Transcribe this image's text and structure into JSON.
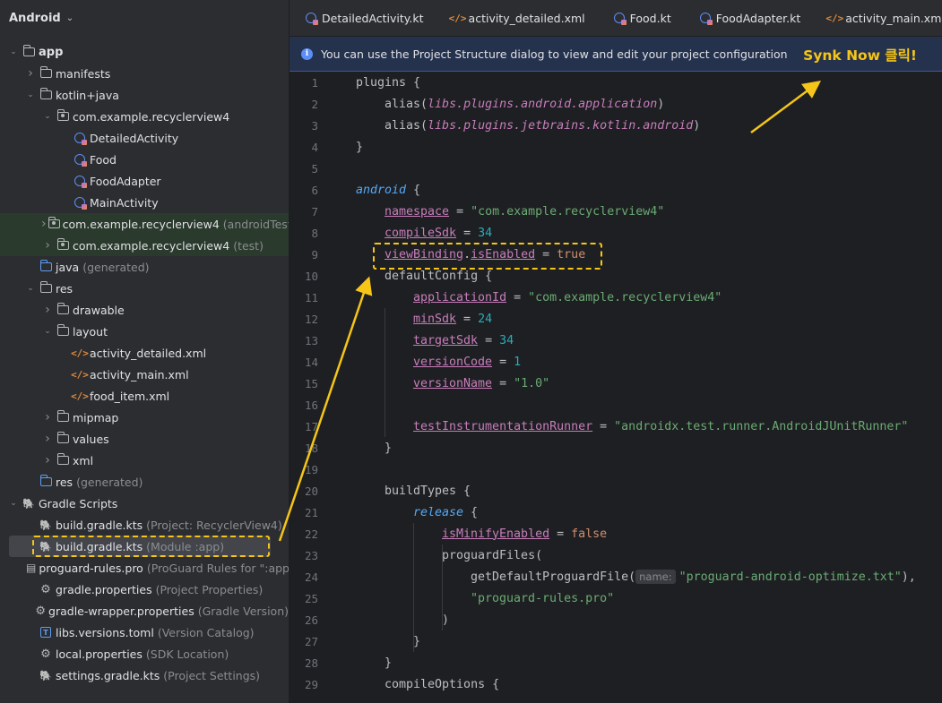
{
  "sidebar": {
    "title": "Android",
    "tree": [
      {
        "label": "app",
        "icon": "module-folder-icon",
        "arrow": "▾",
        "depth": 0,
        "bold": true
      },
      {
        "label": "manifests",
        "icon": "folder-icon",
        "arrow": "›",
        "depth": 1
      },
      {
        "label": "kotlin+java",
        "icon": "folder-icon",
        "arrow": "▾",
        "depth": 1
      },
      {
        "label": "com.example.recyclerview4",
        "icon": "package-icon",
        "arrow": "▾",
        "depth": 2
      },
      {
        "label": "DetailedActivity",
        "icon": "kotlin-class-icon",
        "depth": 3
      },
      {
        "label": "Food",
        "icon": "kotlin-class-icon",
        "depth": 3
      },
      {
        "label": "FoodAdapter",
        "icon": "kotlin-class-icon",
        "depth": 3
      },
      {
        "label": "MainActivity",
        "icon": "kotlin-class-icon",
        "depth": 3
      },
      {
        "label": "com.example.recyclerview4",
        "sub": "(androidTest)",
        "icon": "package-icon",
        "arrow": "›",
        "depth": 2,
        "green": true
      },
      {
        "label": "com.example.recyclerview4",
        "sub": "(test)",
        "icon": "package-icon",
        "arrow": "›",
        "depth": 2,
        "green": true
      },
      {
        "label": "java",
        "sub": "(generated)",
        "icon": "generated-folder-icon",
        "depth": 1
      },
      {
        "label": "res",
        "icon": "folder-icon",
        "arrow": "▾",
        "depth": 1
      },
      {
        "label": "drawable",
        "icon": "folder-icon",
        "arrow": "›",
        "depth": 2
      },
      {
        "label": "layout",
        "icon": "folder-icon",
        "arrow": "▾",
        "depth": 2
      },
      {
        "label": "activity_detailed.xml",
        "icon": "xml-icon",
        "depth": 3
      },
      {
        "label": "activity_main.xml",
        "icon": "xml-icon",
        "depth": 3
      },
      {
        "label": "food_item.xml",
        "icon": "xml-icon",
        "depth": 3
      },
      {
        "label": "mipmap",
        "icon": "folder-icon",
        "arrow": "›",
        "depth": 2
      },
      {
        "label": "values",
        "icon": "folder-icon",
        "arrow": "›",
        "depth": 2
      },
      {
        "label": "xml",
        "icon": "folder-icon",
        "arrow": "›",
        "depth": 2
      },
      {
        "label": "res",
        "sub": "(generated)",
        "icon": "generated-folder-icon",
        "depth": 1
      },
      {
        "label": "Gradle Scripts",
        "icon": "gradle-icon",
        "arrow": "▾",
        "depth": 0
      },
      {
        "label": "build.gradle.kts",
        "sub": "(Project: RecyclerView4)",
        "icon": "gradle-icon",
        "depth": 1
      },
      {
        "label": "build.gradle.kts",
        "sub": "(Module :app)",
        "icon": "gradle-icon",
        "depth": 1,
        "selected": true
      },
      {
        "label": "proguard-rules.pro",
        "sub": "(ProGuard Rules for \":app\")",
        "icon": "file-icon",
        "depth": 1
      },
      {
        "label": "gradle.properties",
        "sub": "(Project Properties)",
        "icon": "gear-icon",
        "depth": 1
      },
      {
        "label": "gradle-wrapper.properties",
        "sub": "(Gradle Version)",
        "icon": "gear-icon",
        "depth": 1
      },
      {
        "label": "libs.versions.toml",
        "sub": "(Version Catalog)",
        "icon": "toml-icon",
        "depth": 1
      },
      {
        "label": "local.properties",
        "sub": "(SDK Location)",
        "icon": "gear-icon",
        "depth": 1
      },
      {
        "label": "settings.gradle.kts",
        "sub": "(Project Settings)",
        "icon": "gradle-icon",
        "depth": 1
      }
    ]
  },
  "tabs": [
    {
      "label": "DetailedActivity.kt",
      "icon": "kotlin-class-icon"
    },
    {
      "label": "activity_detailed.xml",
      "icon": "xml-icon"
    },
    {
      "label": "Food.kt",
      "icon": "kotlin-class-icon"
    },
    {
      "label": "FoodAdapter.kt",
      "icon": "kotlin-class-icon"
    },
    {
      "label": "activity_main.xml",
      "icon": "xml-icon"
    }
  ],
  "banner": {
    "text": "You can use the Project Structure dialog to view and edit your project configuration",
    "annotation": "Synk Now 클릭!"
  },
  "editor": {
    "lines": [
      {
        "n": "1",
        "indent": 0,
        "tokens": [
          {
            "t": "plugins {",
            "c": ""
          }
        ]
      },
      {
        "n": "2",
        "indent": 1,
        "tokens": [
          {
            "t": "alias(",
            "c": ""
          },
          {
            "t": "libs.plugins.android.application",
            "c": "ital"
          },
          {
            "t": ")",
            "c": ""
          }
        ]
      },
      {
        "n": "3",
        "indent": 1,
        "tokens": [
          {
            "t": "alias(",
            "c": ""
          },
          {
            "t": "libs.plugins.jetbrains.kotlin.android",
            "c": "ital"
          },
          {
            "t": ")",
            "c": ""
          }
        ]
      },
      {
        "n": "4",
        "indent": 0,
        "tokens": [
          {
            "t": "}",
            "c": ""
          }
        ]
      },
      {
        "n": "5",
        "indent": 0,
        "tokens": []
      },
      {
        "n": "6",
        "indent": 0,
        "tokens": [
          {
            "t": "android",
            "c": "blue"
          },
          {
            "t": " {",
            "c": ""
          }
        ]
      },
      {
        "n": "7",
        "indent": 1,
        "tokens": [
          {
            "t": "namespace",
            "c": "prop"
          },
          {
            "t": " = ",
            "c": ""
          },
          {
            "t": "\"com.example.recyclerview4\"",
            "c": "str"
          }
        ]
      },
      {
        "n": "8",
        "indent": 1,
        "tokens": [
          {
            "t": "compileSdk",
            "c": "prop"
          },
          {
            "t": " = ",
            "c": ""
          },
          {
            "t": "34",
            "c": "num"
          }
        ]
      },
      {
        "n": "9",
        "indent": 1,
        "tokens": [
          {
            "t": "viewBinding",
            "c": "prop"
          },
          {
            "t": ".",
            "c": ""
          },
          {
            "t": "isEnabled",
            "c": "prop"
          },
          {
            "t": " = ",
            "c": ""
          },
          {
            "t": "true",
            "c": "kw"
          }
        ]
      },
      {
        "n": "10",
        "indent": 1,
        "tokens": [
          {
            "t": "defaultConfig {",
            "c": ""
          }
        ]
      },
      {
        "n": "11",
        "indent": 2,
        "tokens": [
          {
            "t": "applicationId",
            "c": "prop"
          },
          {
            "t": " = ",
            "c": ""
          },
          {
            "t": "\"com.example.recyclerview4\"",
            "c": "str"
          }
        ]
      },
      {
        "n": "12",
        "indent": 2,
        "tokens": [
          {
            "t": "minSdk",
            "c": "prop"
          },
          {
            "t": " = ",
            "c": ""
          },
          {
            "t": "24",
            "c": "num"
          }
        ]
      },
      {
        "n": "13",
        "indent": 2,
        "tokens": [
          {
            "t": "targetSdk",
            "c": "prop"
          },
          {
            "t": " = ",
            "c": ""
          },
          {
            "t": "34",
            "c": "num"
          }
        ]
      },
      {
        "n": "14",
        "indent": 2,
        "tokens": [
          {
            "t": "versionCode",
            "c": "prop"
          },
          {
            "t": " = ",
            "c": ""
          },
          {
            "t": "1",
            "c": "num"
          }
        ]
      },
      {
        "n": "15",
        "indent": 2,
        "tokens": [
          {
            "t": "versionName",
            "c": "prop"
          },
          {
            "t": " = ",
            "c": ""
          },
          {
            "t": "\"1.0\"",
            "c": "str"
          }
        ]
      },
      {
        "n": "16",
        "indent": 0,
        "tokens": []
      },
      {
        "n": "17",
        "indent": 2,
        "tokens": [
          {
            "t": "testInstrumentationRunner",
            "c": "prop"
          },
          {
            "t": " = ",
            "c": ""
          },
          {
            "t": "\"androidx.test.runner.AndroidJUnitRunner\"",
            "c": "str"
          }
        ]
      },
      {
        "n": "18",
        "indent": 1,
        "tokens": [
          {
            "t": "}",
            "c": ""
          }
        ]
      },
      {
        "n": "19",
        "indent": 0,
        "tokens": []
      },
      {
        "n": "20",
        "indent": 1,
        "tokens": [
          {
            "t": "buildTypes {",
            "c": ""
          }
        ]
      },
      {
        "n": "21",
        "indent": 2,
        "tokens": [
          {
            "t": "release",
            "c": "blue"
          },
          {
            "t": " {",
            "c": ""
          }
        ]
      },
      {
        "n": "22",
        "indent": 3,
        "tokens": [
          {
            "t": "isMinifyEnabled",
            "c": "prop"
          },
          {
            "t": " = ",
            "c": ""
          },
          {
            "t": "false",
            "c": "kw"
          }
        ]
      },
      {
        "n": "23",
        "indent": 3,
        "tokens": [
          {
            "t": "proguardFiles(",
            "c": ""
          }
        ]
      },
      {
        "n": "24",
        "indent": 4,
        "tokens": [
          {
            "t": "getDefaultProguardFile(",
            "c": ""
          },
          {
            "t": "name:",
            "c": "hint"
          },
          {
            "t": "\"proguard-android-optimize.txt\"",
            "c": "str"
          },
          {
            "t": "),",
            "c": ""
          }
        ]
      },
      {
        "n": "25",
        "indent": 4,
        "tokens": [
          {
            "t": "\"proguard-rules.pro\"",
            "c": "str"
          }
        ]
      },
      {
        "n": "26",
        "indent": 3,
        "tokens": [
          {
            "t": ")",
            "c": ""
          }
        ]
      },
      {
        "n": "27",
        "indent": 2,
        "tokens": [
          {
            "t": "}",
            "c": ""
          }
        ]
      },
      {
        "n": "28",
        "indent": 1,
        "tokens": [
          {
            "t": "}",
            "c": ""
          }
        ]
      },
      {
        "n": "29",
        "indent": 1,
        "tokens": [
          {
            "t": "compileOptions {",
            "c": ""
          }
        ]
      }
    ]
  },
  "colors": {
    "annotation": "#f5c518",
    "accent": "#5d8ef5"
  }
}
